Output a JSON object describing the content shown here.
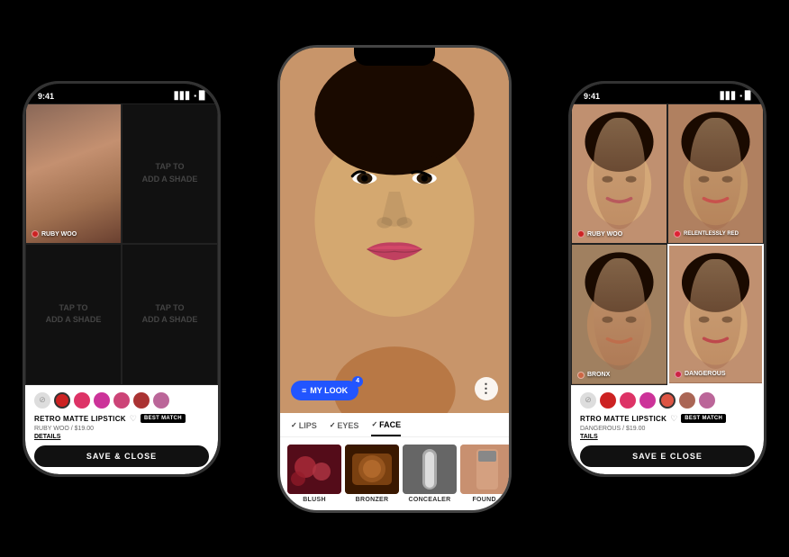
{
  "phones": {
    "left": {
      "statusBar": {
        "time": "9:41",
        "signal": "▋▋▋",
        "wifi": "WiFi",
        "battery": "🔋"
      },
      "grid": {
        "cell1": {
          "hasImage": true,
          "shadeLabel": "RUBY WOO"
        },
        "cell2": {
          "tapText": "TAP TO\nADD A SHADE"
        },
        "cell3": {
          "tapText": "TAP TO\nADD A SHADE"
        },
        "cell4": {
          "tapText": "TAP TO\nADD A SHADE"
        }
      },
      "swatches": [
        {
          "color": "#888",
          "type": "selector"
        },
        {
          "color": "#cc2222"
        },
        {
          "color": "#dd3366"
        },
        {
          "color": "#cc3399"
        },
        {
          "color": "#cc4477"
        },
        {
          "color": "#aa3333"
        },
        {
          "color": "#bb6699"
        }
      ],
      "product": {
        "name": "RETRO MATTE LIPSTICK",
        "shadeName": "RUBY WOO",
        "price": "$19.00",
        "badge": "BEST MATCH",
        "detailsLabel": "DETAILS"
      },
      "saveButton": "SAVE & CLOSE"
    },
    "center": {
      "statusBar": {
        "time": "",
        "signal": "",
        "wifi": "",
        "battery": ""
      },
      "myLookButton": "MY LOOK",
      "myLookCount": "4",
      "tabs": [
        {
          "label": "LIPS",
          "active": false,
          "check": true
        },
        {
          "label": "EYES",
          "active": false,
          "check": true
        },
        {
          "label": "FACE",
          "active": true,
          "check": true
        }
      ],
      "categories": [
        {
          "label": "BLUSH",
          "thumbClass": "thumb-blush"
        },
        {
          "label": "BRONZER",
          "thumbClass": "thumb-bronzer"
        },
        {
          "label": "CONCEALER",
          "thumbClass": "thumb-concealer"
        },
        {
          "label": "FOUND...",
          "thumbClass": "thumb-found"
        }
      ]
    },
    "right": {
      "statusBar": {
        "time": "9:41",
        "signal": "▋▋▋",
        "wifi": "WiFi",
        "battery": "🔋"
      },
      "grid": {
        "cell1": {
          "shadeLabel": "RUBY WOO",
          "dotColor": "#cc2222"
        },
        "cell2": {
          "shadeLabel": "RELENTLESSLY RED",
          "dotColor": "#dd2233"
        },
        "cell3": {
          "shadeLabel": "BRONX",
          "dotColor": "#cc6644"
        },
        "cell4": {
          "shadeLabel": "DANGEROUS",
          "dotColor": "#cc2244",
          "selected": true
        }
      },
      "swatches": [
        {
          "color": "#888",
          "type": "selector"
        },
        {
          "color": "#cc2222"
        },
        {
          "color": "#dd3366"
        },
        {
          "color": "#cc3399"
        },
        {
          "color": "#dd5544"
        },
        {
          "color": "#aa6655"
        },
        {
          "color": "#bb6699"
        }
      ],
      "product": {
        "name": "RTRO MATTE LIPSTICK",
        "shadeName": "DANGEROUS",
        "price": "$19.00",
        "badge": "BEST MATCH",
        "detailsLabel": "TAILS"
      },
      "saveButton": "SAVE E CLOSE"
    }
  }
}
